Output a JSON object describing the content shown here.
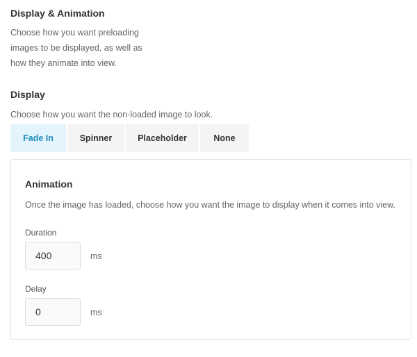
{
  "main": {
    "title": "Display & Animation",
    "description": "Choose how you want preloading images to be displayed, as well as how they animate into view."
  },
  "display": {
    "title": "Display",
    "description": "Choose how you want the non-loaded image to look.",
    "tabs": [
      {
        "label": "Fade In",
        "active": true
      },
      {
        "label": "Spinner",
        "active": false
      },
      {
        "label": "Placeholder",
        "active": false
      },
      {
        "label": "None",
        "active": false
      }
    ]
  },
  "animation": {
    "title": "Animation",
    "description": "Once the image has loaded, choose how you want the image to display when it comes into view.",
    "duration": {
      "label": "Duration",
      "value": "400",
      "unit": "ms"
    },
    "delay": {
      "label": "Delay",
      "value": "0",
      "unit": "ms"
    }
  },
  "colors": {
    "active_tab_bg": "#e4f4fc",
    "active_tab_text": "#1e8cbe",
    "tab_bg": "#f4f4f4"
  }
}
